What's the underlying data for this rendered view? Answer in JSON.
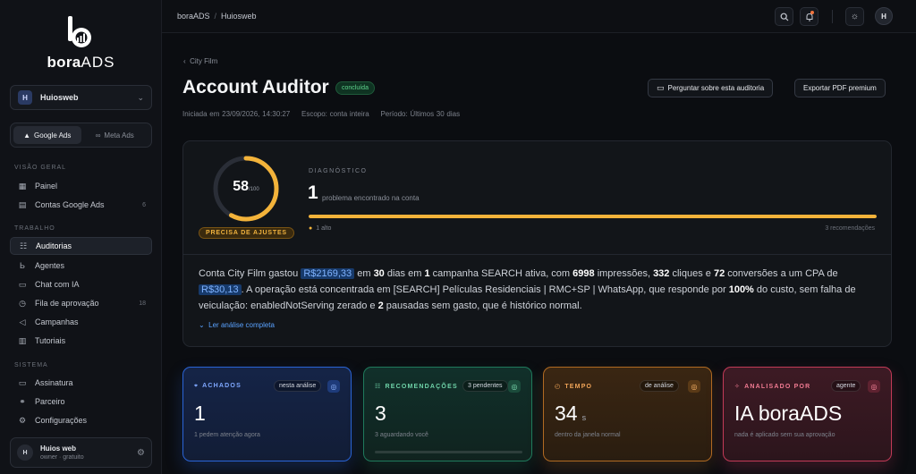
{
  "brand": {
    "name_bold": "bora",
    "name_thin": "ADS"
  },
  "workspace": {
    "badge": "H",
    "name": "Huiosweb"
  },
  "platforms": [
    {
      "label": "Google Ads",
      "active": true
    },
    {
      "label": "Meta Ads",
      "active": false
    }
  ],
  "nav": {
    "overview_title": "VISÃO GERAL",
    "overview": [
      {
        "label": "Painel",
        "icon": "grid-icon"
      },
      {
        "label": "Contas Google Ads",
        "icon": "accounts-icon",
        "count": "6"
      }
    ],
    "work_title": "TRABALHO",
    "work": [
      {
        "label": "Auditorias",
        "icon": "list-check-icon",
        "active": true
      },
      {
        "label": "Agentes",
        "icon": "agent-icon"
      },
      {
        "label": "Chat com IA",
        "icon": "chat-icon"
      },
      {
        "label": "Fila de aprovação",
        "icon": "clock-icon",
        "count": "18"
      },
      {
        "label": "Campanhas",
        "icon": "megaphone-icon"
      },
      {
        "label": "Tutoriais",
        "icon": "book-icon"
      }
    ],
    "system_title": "SISTEMA",
    "system": [
      {
        "label": "Assinatura",
        "icon": "card-icon"
      },
      {
        "label": "Parceiro",
        "icon": "handshake-icon"
      },
      {
        "label": "Configurações",
        "icon": "gear-icon"
      }
    ]
  },
  "user": {
    "initial": "H",
    "name": "Huios web",
    "sub": "owner · gratuito"
  },
  "breadcrumb": {
    "root": "boraADS",
    "current": "Huiosweb"
  },
  "topbar": {
    "avatar": "H"
  },
  "page": {
    "back_label": "City Film",
    "title": "Account Auditor",
    "status": "concluída",
    "started": "Iniciada em 23/09/2026, 14:30:27",
    "scope": "Escopo: conta inteira",
    "period": "Período: Últimos 30 dias",
    "ask_button": "Perguntar sobre esta auditoria",
    "export_button": "Exportar PDF premium"
  },
  "diagnosis": {
    "score": "58",
    "score_max": "/100",
    "score_fraction": 0.58,
    "verdict": "PRECISA DE AJUSTES",
    "label": "DIAGNÓSTICO",
    "count": "1",
    "desc": "problema encontrado na conta",
    "bar_fraction": 1.0,
    "severity": "1 alto",
    "recommendations": "3 recomendações",
    "accent_color": "#f3b33a"
  },
  "analysis": {
    "t1": "Conta City Film gastou ",
    "spend": "R$2169,33",
    "t2": " em ",
    "days": "30",
    "t3": " dias em ",
    "campaigns": "1",
    "t4": " campanha SEARCH ativa, com ",
    "impressions": "6998",
    "t5": " impressões, ",
    "clicks": "332",
    "t6": " cliques e ",
    "conversions": "72",
    "t7": " conversões a um CPA de ",
    "cpa": "R$30,13",
    "t8": ". A operação está concentrada em [SEARCH] Películas Residenciais | RMC+SP | WhatsApp, que responde por ",
    "share": "100%",
    "t9": " do custo, sem falha de veiculação: enabledNotServing zerado e ",
    "paused": "2",
    "t10": " pausadas sem gasto, que é histórico normal.",
    "more": "Ler análise completa"
  },
  "kpis": [
    {
      "label": "ACHADOS",
      "tag": "nesta análise",
      "value": "1",
      "unit": "",
      "sub": "1 pedem atenção agora"
    },
    {
      "label": "RECOMENDAÇÕES",
      "tag": "3 pendentes",
      "value": "3",
      "unit": "",
      "sub": "3 aguardando você"
    },
    {
      "label": "TEMPO",
      "tag": "de análise",
      "value": "34",
      "unit": "s",
      "sub": "dentro da janela normal"
    },
    {
      "label": "ANALISADO POR",
      "tag": "agente",
      "value": "IA boraADS",
      "unit": "",
      "sub": "nada é aplicado sem sua aprovação"
    }
  ]
}
